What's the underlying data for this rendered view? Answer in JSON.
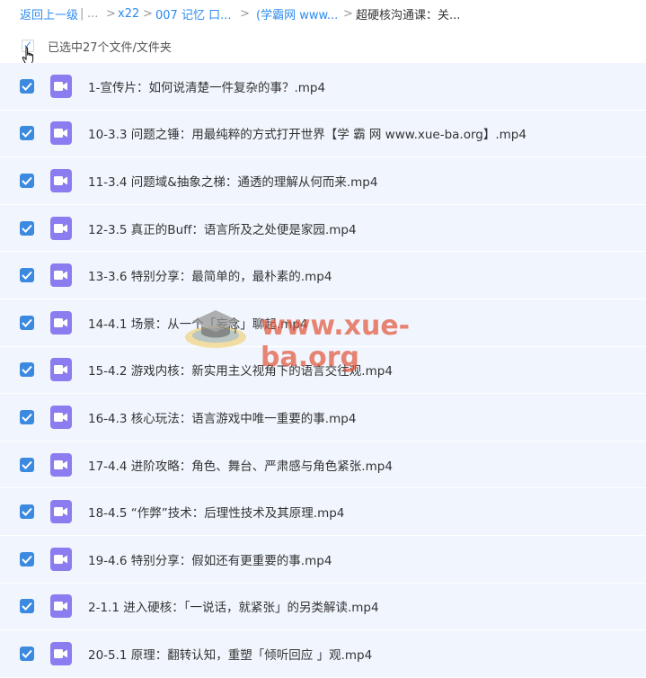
{
  "breadcrumb": {
    "back": "返回上一级",
    "sep": "|",
    "ellipsis1": "...",
    "arrow": ">",
    "crumb1": "x22",
    "crumb2": "007 记忆 口...",
    "crumb3": "(学霸网 www...",
    "current": "超硬核沟通课：关..."
  },
  "selection": {
    "label": "已选中27个文件/文件夹",
    "tick": "✓"
  },
  "files": [
    "1-宣传片：如何说清楚一件复杂的事？.mp4",
    "10-3.3 问题之锤：用最纯粹的方式打开世界【学 霸 网 www.xue-ba.org】.mp4",
    "11-3.4 问题域&抽象之梯：通透的理解从何而来.mp4",
    "12-3.5 真正的Buff：语言所及之处便是家园.mp4",
    "13-3.6 特别分享：最简单的，最朴素的.mp4",
    "14-4.1 场景：从一个「妄念」聊起.mp4",
    "15-4.2 游戏内核：新实用主义视角下的语言交往观.mp4",
    "16-4.3 核心玩法：语言游戏中唯一重要的事.mp4",
    "17-4.4 进阶攻略：角色、舞台、严肃感与角色紧张.mp4",
    "18-4.5 “作弊”技术：后理性技术及其原理.mp4",
    "19-4.6 特别分享：假如还有更重要的事.mp4",
    "2-1.1 进入硬核：「一说话，就紧张」的另类解读.mp4",
    "20-5.1 原理：翻转认知，重塑「倾听回应 」观.mp4"
  ],
  "icons": {
    "checkbox": "checkmark-icon",
    "file": "video-file-icon",
    "cursor": "hand-pointer-icon"
  },
  "colors": {
    "accent": "#3b8ae0",
    "link": "#2d8cf0",
    "row_bg": "#f1f6fe",
    "video_icon": "#8b7cf0",
    "watermark": "#e2563c"
  },
  "watermark": {
    "text": "www.xue-ba.org"
  }
}
